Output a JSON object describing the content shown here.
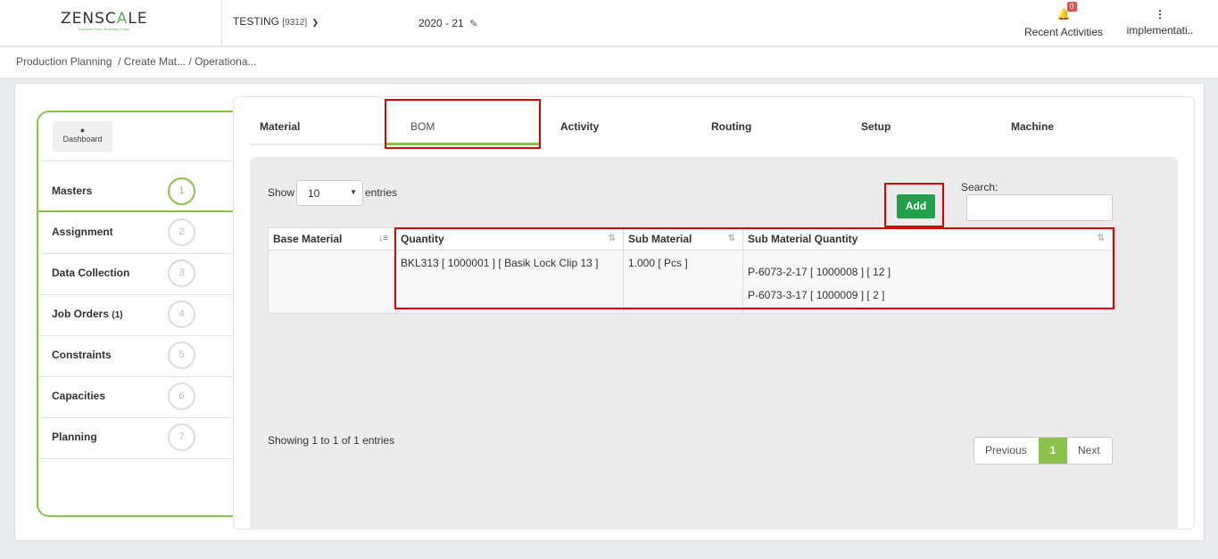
{
  "brand": {
    "name_left": "ZENSC",
    "name_accent": "A",
    "name_right": "LE",
    "tagline": "Business Ease. Business Peace."
  },
  "header": {
    "company": "TESTING",
    "company_code": "[9312]",
    "fiscal_year": "2020 - 21",
    "notifications_count": "0",
    "recent_activities": "Recent Activities",
    "user": "implementati.."
  },
  "breadcrumb": {
    "root": "Production Planning",
    "trail": "/ Create Mat... / Operationa..."
  },
  "sidebar": {
    "dashboard": "Dashboard",
    "steps": [
      {
        "label": "Masters",
        "num": "1",
        "count": ""
      },
      {
        "label": "Assignment",
        "num": "2",
        "count": ""
      },
      {
        "label": "Data Collection",
        "num": "3",
        "count": ""
      },
      {
        "label": "Job Orders",
        "num": "4",
        "count": "(1)"
      },
      {
        "label": "Constraints",
        "num": "5",
        "count": ""
      },
      {
        "label": "Capacities",
        "num": "6",
        "count": ""
      },
      {
        "label": "Planning",
        "num": "7",
        "count": ""
      }
    ]
  },
  "tabs": [
    "Material",
    "BOM",
    "Activity",
    "Routing",
    "Setup",
    "Machine"
  ],
  "table_controls": {
    "show": "Show",
    "page_size": "10",
    "entries": "entries",
    "add": "Add",
    "search_label": "Search:",
    "search_value": ""
  },
  "table": {
    "headers": [
      "Base Material",
      "Quantity",
      "Sub Material",
      "Sub Material Quantity"
    ],
    "row": {
      "base_material": "",
      "quantity": "BKL313 [ 1000001 ] [ Basik Lock Clip 13 ]",
      "sub_material": "1.000 [ Pcs ]",
      "sub_material_quantity": [
        "P-6073-2-17 [ 1000008 ] [ 12 ]",
        "P-6073-3-17 [ 1000009 ] [ 2 ]"
      ]
    }
  },
  "footer": {
    "info": "Showing 1 to 1 of 1 entries",
    "previous": "Previous",
    "current_page": "1",
    "next": "Next"
  },
  "colors": {
    "accent_green": "#8bc34a",
    "add_button": "#22a04b",
    "highlight_red": "#e00000",
    "badge_red": "#d9534f"
  }
}
